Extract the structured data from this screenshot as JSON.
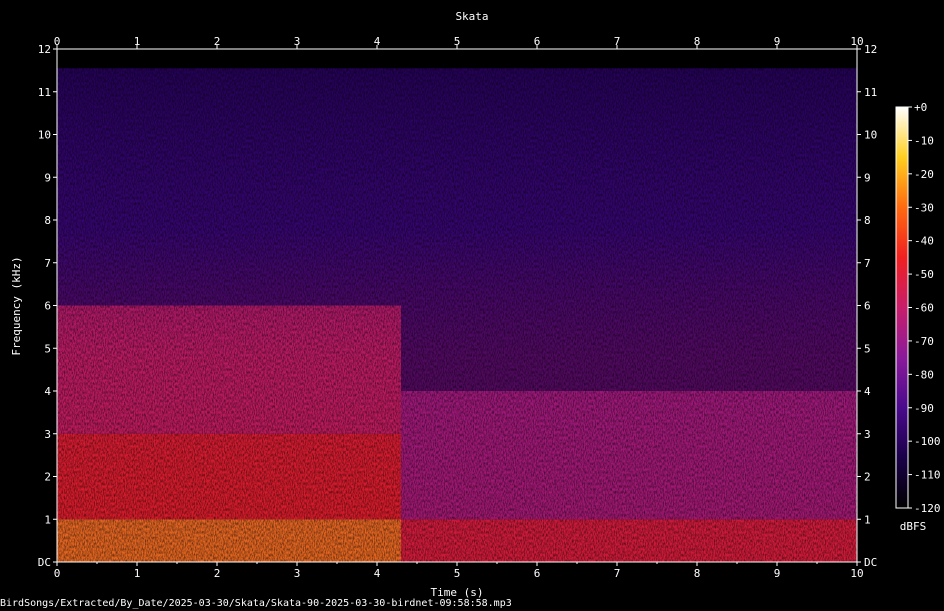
{
  "chart_data": {
    "type": "heatmap",
    "title": "Skata",
    "xlabel": "Time (s)",
    "ylabel": "Frequency (kHz)",
    "xlim": [
      0,
      10
    ],
    "ylim": [
      0,
      12
    ],
    "x_ticks": [
      "0",
      "1",
      "2",
      "3",
      "4",
      "5",
      "6",
      "7",
      "8",
      "9",
      "10"
    ],
    "y_ticks": [
      "DC",
      "1",
      "2",
      "3",
      "4",
      "5",
      "6",
      "7",
      "8",
      "9",
      "10",
      "11",
      "12"
    ],
    "colorbar": {
      "label": "dBFS",
      "ticks": [
        "+0",
        "-10",
        "-20",
        "-30",
        "-40",
        "-50",
        "-60",
        "-70",
        "-80",
        "-90",
        "-100",
        "-110",
        "-120"
      ],
      "range": [
        -120,
        0
      ],
      "colors": [
        "#000000",
        "#1a0048",
        "#4a0a8c",
        "#8a1a9a",
        "#c81e6a",
        "#f02020",
        "#ff6a10",
        "#ffd020",
        "#ffffff"
      ]
    },
    "energy_regions": [
      {
        "t": [
          0,
          4.3
        ],
        "f": [
          0,
          1
        ],
        "level_db": -25
      },
      {
        "t": [
          0,
          4.3
        ],
        "f": [
          1,
          3
        ],
        "level_db": -45
      },
      {
        "t": [
          0,
          4.3
        ],
        "f": [
          3,
          6
        ],
        "level_db": -58
      },
      {
        "t": [
          4.3,
          10
        ],
        "f": [
          0,
          1
        ],
        "level_db": -50
      },
      {
        "t": [
          4.3,
          10
        ],
        "f": [
          1,
          4
        ],
        "level_db": -70
      },
      {
        "t": [
          4.3,
          10
        ],
        "f": [
          5,
          12
        ],
        "level_db": -100
      }
    ]
  },
  "footer": "BirdSongs/Extracted/By_Date/2025-03-30/Skata/Skata-90-2025-03-30-birdnet-09:58:58.mp3"
}
